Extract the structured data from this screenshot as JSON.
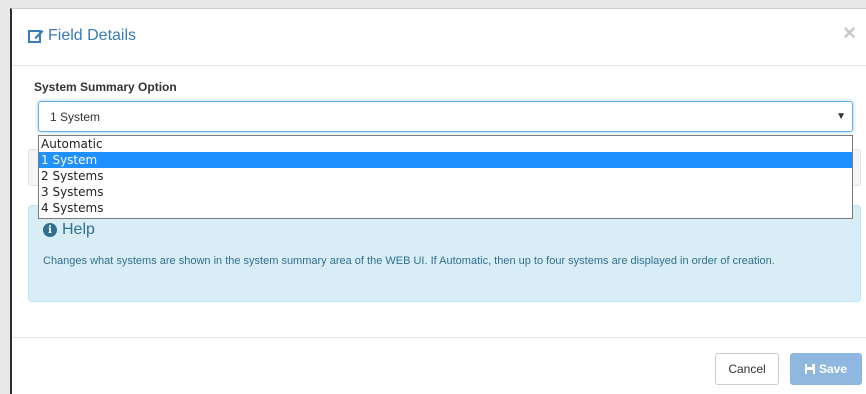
{
  "modal": {
    "title": "Field Details",
    "close_glyph": "×",
    "icons": {
      "edit": "edit-icon",
      "close": "close-icon"
    }
  },
  "field": {
    "label": "System Summary Option",
    "selected_value": "1 System",
    "caret": "▼",
    "options": [
      "Automatic",
      "1 System",
      "2 Systems",
      "3 Systems",
      "4 Systems"
    ],
    "selected_index": 1
  },
  "help": {
    "icon": "info-icon",
    "icon_glyph": "i",
    "title": "Help",
    "text": "Changes what systems are shown in the system summary area of the WEB UI. If Automatic, then up to four systems are displayed in order of creation."
  },
  "footer": {
    "cancel_label": "Cancel",
    "save_label": "Save",
    "save_icon": "floppy-disk-icon"
  },
  "colors": {
    "title": "#3a7bb8",
    "help_bg": "#d9edf7",
    "help_text": "#31708f",
    "selected_option": "#1e90ff",
    "save_button": "#8fb7df"
  }
}
